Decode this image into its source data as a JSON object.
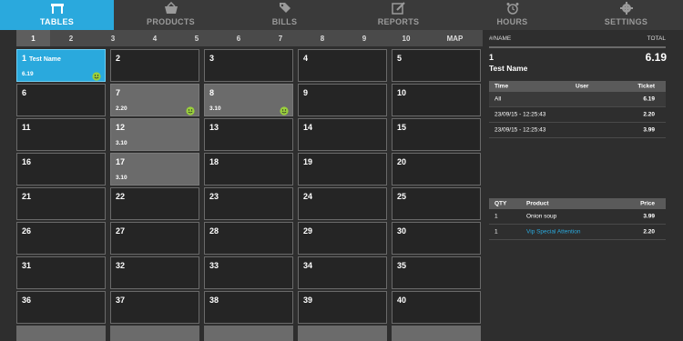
{
  "nav": {
    "tabs": [
      {
        "label": "TABLES",
        "icon": "table-icon"
      },
      {
        "label": "PRODUCTS",
        "icon": "basket-icon"
      },
      {
        "label": "BILLS",
        "icon": "tags-icon"
      },
      {
        "label": "REPORTS",
        "icon": "edit-report-icon"
      },
      {
        "label": "HOURS",
        "icon": "alarm-clock-icon"
      },
      {
        "label": "SETTINGS",
        "icon": "gear-icon"
      }
    ],
    "active": "TABLES",
    "accent": "#2aa9dd"
  },
  "pages": [
    "1",
    "2",
    "3",
    "4",
    "5",
    "6",
    "7",
    "8",
    "9",
    "10",
    "MAP"
  ],
  "active_page": "1",
  "tables": [
    {
      "num": "1",
      "name": "Test Name",
      "amount": "6.19",
      "state": "selected",
      "smiley": true
    },
    {
      "num": "2"
    },
    {
      "num": "3"
    },
    {
      "num": "4"
    },
    {
      "num": "5"
    },
    {
      "num": "6"
    },
    {
      "num": "7",
      "amount": "2.20",
      "state": "occupied",
      "smiley": true
    },
    {
      "num": "8",
      "amount": "3.10",
      "state": "occupied",
      "smiley": true
    },
    {
      "num": "9"
    },
    {
      "num": "10"
    },
    {
      "num": "11"
    },
    {
      "num": "12",
      "amount": "3.10",
      "state": "occupied"
    },
    {
      "num": "13"
    },
    {
      "num": "14"
    },
    {
      "num": "15"
    },
    {
      "num": "16"
    },
    {
      "num": "17",
      "amount": "3.10",
      "state": "occupied"
    },
    {
      "num": "18"
    },
    {
      "num": "19"
    },
    {
      "num": "20"
    },
    {
      "num": "21"
    },
    {
      "num": "22"
    },
    {
      "num": "23"
    },
    {
      "num": "24"
    },
    {
      "num": "25"
    },
    {
      "num": "26"
    },
    {
      "num": "27"
    },
    {
      "num": "28"
    },
    {
      "num": "29"
    },
    {
      "num": "30"
    },
    {
      "num": "31"
    },
    {
      "num": "32"
    },
    {
      "num": "33"
    },
    {
      "num": "34"
    },
    {
      "num": "35"
    },
    {
      "num": "36"
    },
    {
      "num": "37"
    },
    {
      "num": "38"
    },
    {
      "num": "39"
    },
    {
      "num": "40"
    }
  ],
  "detail": {
    "header_left": "#/NAME",
    "header_right": "TOTAL",
    "table_num": "1",
    "table_name": "Test Name",
    "total": "6.19",
    "tickets": {
      "columns": [
        "Time",
        "User",
        "Ticket"
      ],
      "rows": [
        {
          "time": "All",
          "user": "",
          "ticket": "6.19"
        },
        {
          "time": "23/09/15 - 12:25:43",
          "user": "",
          "ticket": "2.20"
        },
        {
          "time": "23/09/15 - 12:25:43",
          "user": "",
          "ticket": "3.99"
        }
      ]
    },
    "products": {
      "columns": [
        "QTY",
        "Product",
        "Price"
      ],
      "rows": [
        {
          "qty": "1",
          "product": "Onion soup",
          "price": "3.99"
        },
        {
          "qty": "1",
          "product": "Vip Special Attention",
          "price": "2.20"
        }
      ]
    }
  }
}
